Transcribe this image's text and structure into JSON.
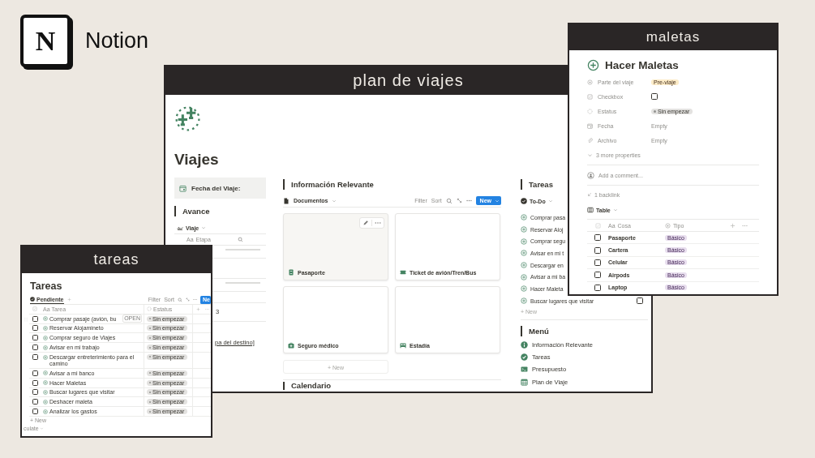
{
  "brand": {
    "logo_mark": "N",
    "name": "Notion"
  },
  "main_window": {
    "title": "plan de viajes",
    "page_title": "Viajes",
    "date_property": {
      "label": "Fecha del Viaje:"
    },
    "progress": {
      "heading": "Avance",
      "view": "Viaje",
      "column_marker": "Aa",
      "column": "Etapa",
      "cell_value": "3",
      "link_fragment": "pa del destino]"
    },
    "documents": {
      "heading": "Información Relevante",
      "view": "Documentos",
      "toolbar": [
        "Filter",
        "Sort"
      ],
      "new_button": "New",
      "cards": [
        {
          "title": "Pasaporte",
          "hovered": true
        },
        {
          "title": "Ticket de avión/Tren/Bus",
          "hovered": false
        },
        {
          "title": "Seguro médico",
          "hovered": false
        },
        {
          "title": "Estadía",
          "hovered": false
        }
      ],
      "add_new": "+ New"
    },
    "calendar_heading": "Calendario",
    "tasks": {
      "heading": "Tareas",
      "view": "To-Do",
      "items": [
        {
          "label": "Comprar pasa"
        },
        {
          "label": "Reservar Aloj"
        },
        {
          "label": "Comprar segu"
        },
        {
          "label": "Avisar en mi t"
        },
        {
          "label": "Descargar en"
        },
        {
          "label": "Avisar a mi ba"
        },
        {
          "label": "Hacer Maleta"
        },
        {
          "label": "Buscar lugares que visitar",
          "checked": false
        }
      ],
      "add_new": "+ New"
    },
    "menu": {
      "heading": "Menú",
      "items": [
        {
          "label": "Información Relevante"
        },
        {
          "label": "Tareas"
        },
        {
          "label": "Presupuesto"
        },
        {
          "label": "Plan de Viaje"
        }
      ]
    }
  },
  "maletas_window": {
    "title": "maletas",
    "page_title": "Hacer Maletas",
    "properties": [
      {
        "label": "Parte del viaje",
        "kind": "select",
        "value": "Pre-viaje"
      },
      {
        "label": "Checkbox",
        "kind": "checkbox",
        "checked": false
      },
      {
        "label": "Estatus",
        "kind": "status",
        "value": "Sin empezar"
      },
      {
        "label": "Fecha",
        "kind": "empty",
        "value": "Empty"
      },
      {
        "label": "Archivo",
        "kind": "empty",
        "value": "Empty"
      }
    ],
    "more_properties": "3 more properties",
    "comment_placeholder": "Add a comment...",
    "backlinks": "1 backlink",
    "view": "Table",
    "columns": [
      {
        "marker": "Aa",
        "label": "Cosa"
      },
      {
        "label": "Tipo"
      }
    ],
    "rows": [
      {
        "name": "Pasaporte",
        "type": "Básico",
        "checked": false
      },
      {
        "name": "Cartera",
        "type": "Básico",
        "checked": false
      },
      {
        "name": "Celular",
        "type": "Básico",
        "checked": false
      },
      {
        "name": "Airpods",
        "type": "Básico",
        "checked": false
      },
      {
        "name": "Laptop",
        "type": "Básico",
        "checked": false
      }
    ]
  },
  "tareas_window": {
    "title": "tareas",
    "page_title": "Tareas",
    "view": {
      "label": "Pendiente",
      "selected": true
    },
    "toolbar": [
      "Filter",
      "Sort"
    ],
    "new_button": "Ne",
    "columns": [
      {
        "marker": "Aa",
        "label": "Tarea"
      },
      {
        "label": "Estatus"
      }
    ],
    "rows": [
      {
        "name": "Comprar pasaje (avión, bu",
        "badge": "OPEN",
        "status": "Sin empezar",
        "checked": false
      },
      {
        "name": "Reservar Alojamineto",
        "status": "Sin empezar",
        "checked": false
      },
      {
        "name": "Comprar seguro de Viajes",
        "status": "Sin empezar",
        "checked": false
      },
      {
        "name": "Avisar en mi trabajo",
        "status": "Sin empezar",
        "checked": false
      },
      {
        "name": "Descargar entreterimiento para el camino",
        "status": "Sin empezar",
        "checked": false
      },
      {
        "name": "Avisar a mi banco",
        "status": "Sin empezar",
        "checked": false
      },
      {
        "name": "Hacer Maletas",
        "status": "Sin empezar",
        "checked": false
      },
      {
        "name": "Buscar lugares que visitar",
        "status": "Sin empezar",
        "checked": false
      },
      {
        "name": "Deshacer maleta",
        "status": "Sin empezar",
        "checked": false
      },
      {
        "name": "Analizar los gastos",
        "status": "Sin empezar",
        "checked": false
      }
    ],
    "add_new": "+ New",
    "footer": "culate"
  }
}
